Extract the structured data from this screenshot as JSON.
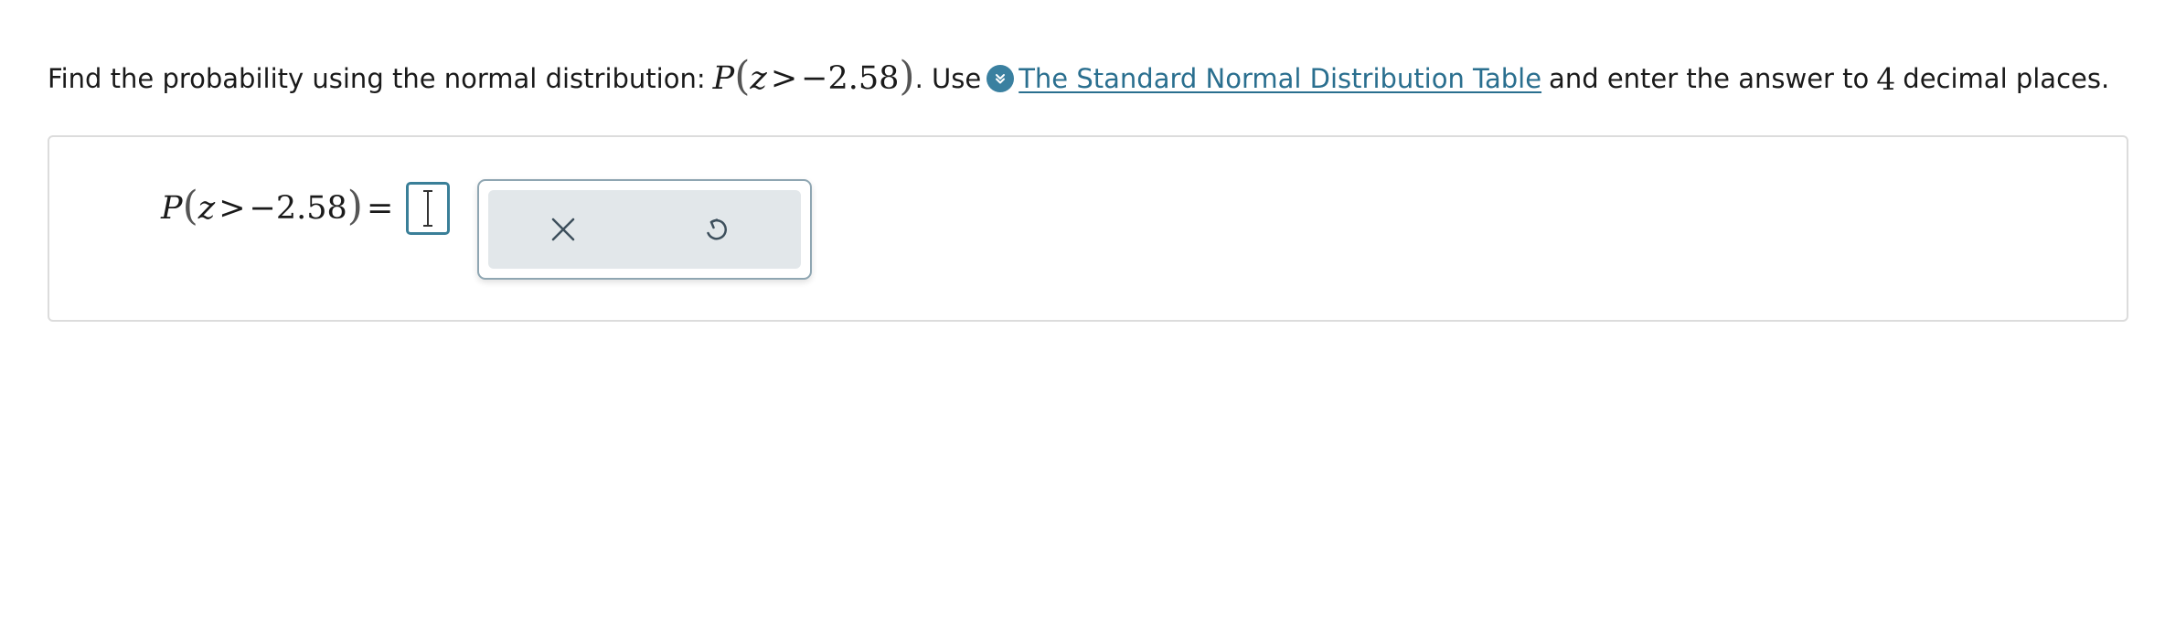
{
  "question": {
    "prefix": "Find the probability using the normal distribution:",
    "expr": {
      "P": "P",
      "z": "z",
      "gt": ">",
      "minus": "−",
      "value": "2.58"
    },
    "after_expr": ". Use",
    "link_text": "The Standard Normal Distribution Table",
    "middle": "and enter the answer to",
    "places_num": "4",
    "suffix": "decimal places."
  },
  "answer": {
    "expr": {
      "P": "P",
      "z": "z",
      "gt": ">",
      "minus": "−",
      "value": "2.58",
      "equals": "="
    },
    "input_value": ""
  },
  "toolbar": {
    "clear_icon": "x-icon",
    "undo_icon": "undo-icon"
  },
  "colors": {
    "accent": "#3a7f98",
    "link": "#2a6f8f",
    "toolbar_bg": "#e2e7ea",
    "panel_border": "#8fa6b2",
    "box_border": "#dcdcdc"
  }
}
